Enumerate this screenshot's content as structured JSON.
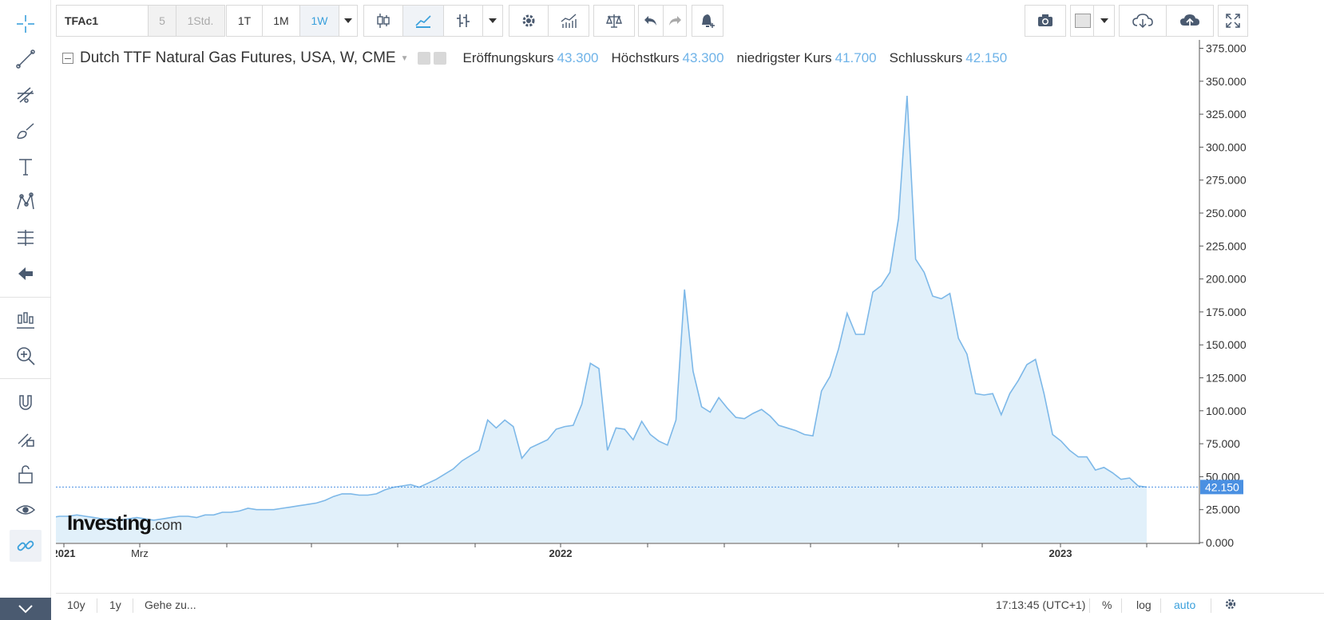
{
  "symbol": "TFAc1",
  "intervals": [
    "5",
    "1Std.",
    "1T",
    "1M",
    "1W"
  ],
  "legend": {
    "title": "Dutch TTF Natural Gas Futures, USA, W, CME",
    "open_label": "Eröffnungskurs",
    "open_value": "43.300",
    "high_label": "Höchstkurs",
    "high_value": "43.300",
    "low_label": "niedrigster Kurs",
    "low_value": "41.700",
    "close_label": "Schlusskurs",
    "close_value": "42.150"
  },
  "watermark": {
    "brand": "Investing",
    "suffix": ".com"
  },
  "bottom": {
    "range_10y": "10y",
    "range_1y": "1y",
    "goto": "Gehe zu...",
    "time": "17:13:45 (UTC+1)",
    "percent": "%",
    "log": "log",
    "auto": "auto"
  },
  "colors": {
    "line": "#7db8e8",
    "fill": "#e1f0fa",
    "accent": "#3aa0dc",
    "price_label": "#4a90e2"
  },
  "icons": {
    "left": [
      "crosshair-icon",
      "trend-line-icon",
      "fib-icon",
      "brush-icon",
      "text-icon",
      "pattern-icon",
      "measure-icon",
      "back-arrow-icon",
      "indicators-icon",
      "zoom-in-icon",
      "magnet-icon",
      "lock-draw-icon",
      "unlock-icon",
      "eye-icon",
      "link-icon"
    ],
    "top": [
      "candles-icon",
      "line-chart-icon",
      "bar-style-icon",
      "settings-icon",
      "indicator-icon",
      "compare-icon",
      "undo-icon",
      "redo-icon",
      "alert-icon",
      "camera-icon",
      "color-box-icon",
      "cloud-download-icon",
      "cloud-upload-icon",
      "fullscreen-icon"
    ]
  },
  "chart_data": {
    "type": "area",
    "title": "Dutch TTF Natural Gas Futures, USA, W, CME",
    "xlabel": "",
    "ylabel": "",
    "ylim": [
      0,
      375
    ],
    "y_ticks": [
      "0.000",
      "25.000",
      "50.000",
      "75.000",
      "100.000",
      "125.000",
      "150.000",
      "175.000",
      "200.000",
      "225.000",
      "250.000",
      "275.000",
      "300.000",
      "325.000",
      "350.000",
      "375.000"
    ],
    "x_ticks": [
      "2021",
      "Mrz",
      "",
      "",
      "",
      "",
      "",
      "",
      "2022",
      "",
      "",
      "",
      "",
      "",
      "",
      "",
      "2023",
      ""
    ],
    "last_price": "42.150",
    "last_value": 42.15,
    "grid": false,
    "values": [
      19,
      20,
      20,
      21,
      20,
      19,
      18,
      18,
      17,
      18,
      19,
      18,
      17,
      18,
      19,
      20,
      20,
      19,
      21,
      21,
      23,
      23,
      24,
      26,
      25,
      25,
      25,
      26,
      27,
      28,
      29,
      30,
      32,
      35,
      37,
      37,
      36,
      36,
      37,
      40,
      42,
      43,
      44,
      42,
      45,
      48,
      52,
      56,
      62,
      66,
      70,
      93,
      87,
      93,
      88,
      64,
      72,
      75,
      78,
      86,
      88,
      89,
      105,
      136,
      132,
      70,
      87,
      86,
      78,
      92,
      82,
      77,
      74,
      93,
      192,
      130,
      103,
      99,
      110,
      102,
      95,
      94,
      98,
      101,
      96,
      89,
      87,
      85,
      82,
      81,
      115,
      126,
      147,
      174,
      158,
      158,
      190,
      195,
      205,
      246,
      339,
      215,
      205,
      187,
      185,
      189,
      155,
      143,
      113,
      112,
      113,
      97,
      113,
      123,
      135,
      139,
      113,
      82,
      77,
      70,
      65,
      65,
      55,
      57,
      53,
      48,
      49,
      43,
      42.15
    ]
  }
}
